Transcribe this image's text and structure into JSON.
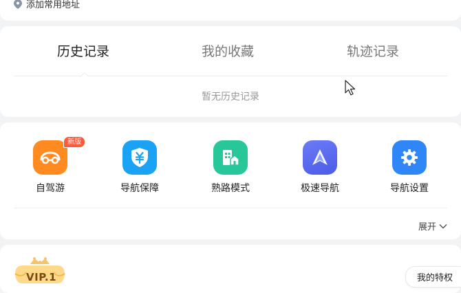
{
  "address": {
    "label": "添加常用地址"
  },
  "history": {
    "tabs": [
      {
        "label": "历史记录",
        "active": true
      },
      {
        "label": "我的收藏",
        "active": false
      },
      {
        "label": "轨迹记录",
        "active": false
      }
    ],
    "empty_message": "暂无历史记录"
  },
  "tools": {
    "items": [
      {
        "label": "自驾游",
        "icon": "car-icon",
        "color": "#ff8a1f",
        "badge": "新版"
      },
      {
        "label": "导航保障",
        "icon": "shield-yen-icon",
        "color": "#1aa3f5"
      },
      {
        "label": "熟路模式",
        "icon": "building-icon",
        "color": "#27c79a"
      },
      {
        "label": "极速导航",
        "icon": "arrow-up-icon",
        "color": "#5a6cf0"
      },
      {
        "label": "导航设置",
        "icon": "gear-icon",
        "color": "#2f86f6"
      }
    ],
    "expand_label": "展开"
  },
  "vip": {
    "level": "VIP.1",
    "privilege_label": "我的特权"
  },
  "colors": {
    "accent": "#2f86f6",
    "background": "#f2f3f5",
    "badge": "#ff5a3c"
  }
}
